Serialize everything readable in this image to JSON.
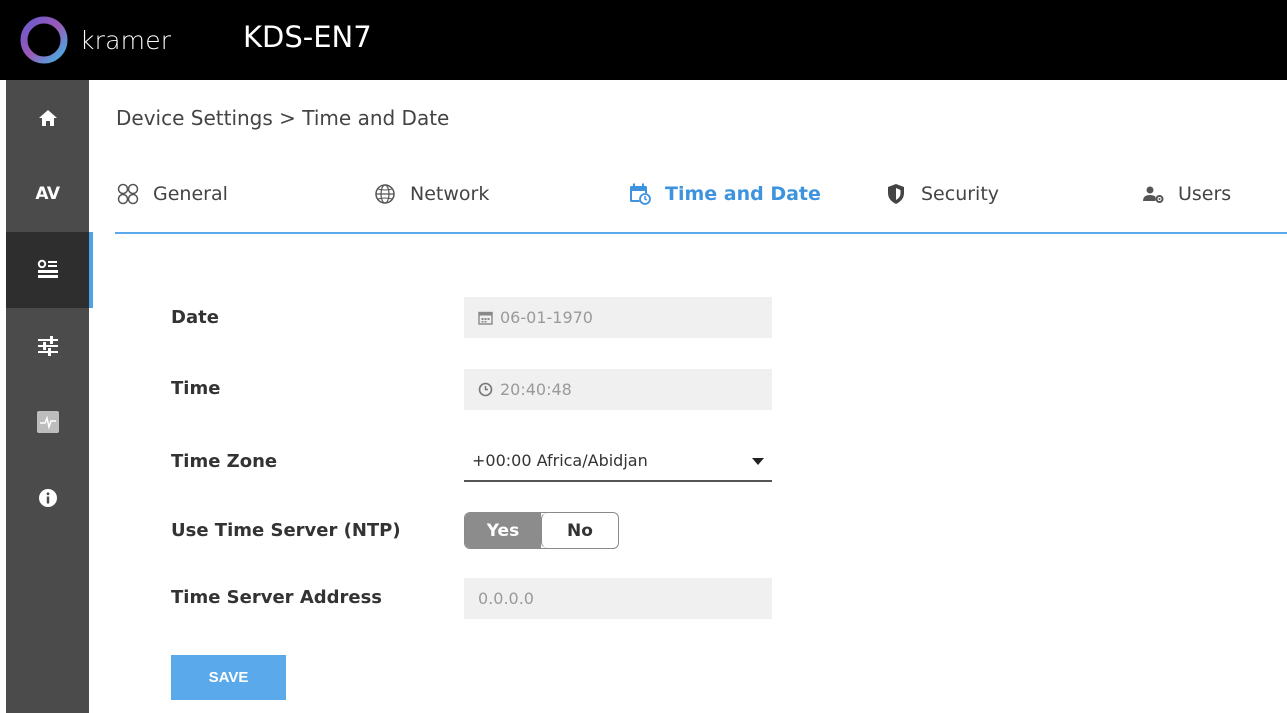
{
  "header": {
    "brand": "kramer",
    "device_name": "KDS-EN7",
    "brand_color": "#000000"
  },
  "sidebar": {
    "items": [
      {
        "id": "home",
        "icon": "home-icon"
      },
      {
        "id": "av",
        "label": "AV"
      },
      {
        "id": "device-settings",
        "icon": "settings-panel-icon",
        "active": true
      },
      {
        "id": "controls",
        "icon": "sliders-icon"
      },
      {
        "id": "diagnostics",
        "icon": "pulse-icon"
      },
      {
        "id": "about",
        "icon": "info-icon"
      }
    ]
  },
  "breadcrumb": "Device Settings > Time and Date",
  "tabs": [
    {
      "label": "General",
      "icon": "general-icon"
    },
    {
      "label": "Network",
      "icon": "globe-icon"
    },
    {
      "label": "Time and Date",
      "icon": "calendar-clock-icon",
      "active": true
    },
    {
      "label": "Security",
      "icon": "shield-icon"
    },
    {
      "label": "Users",
      "icon": "users-gear-icon"
    }
  ],
  "form": {
    "date_label": "Date",
    "date_value": "06-01-1970",
    "time_label": "Time",
    "time_value": "20:40:48",
    "timezone_label": "Time Zone",
    "timezone_value": "+00:00 Africa/Abidjan",
    "ntp_label": "Use Time Server (NTP)",
    "ntp_yes": "Yes",
    "ntp_no": "No",
    "ntp_selected": "Yes",
    "server_label": "Time Server Address",
    "server_value": "0.0.0.0",
    "save_label": "SAVE"
  },
  "colors": {
    "accent": "#5aa9ea",
    "active_tab": "#3d93de",
    "sidebar_bg": "#4b4b4b",
    "sidebar_active_bg": "#2e2e2e"
  }
}
